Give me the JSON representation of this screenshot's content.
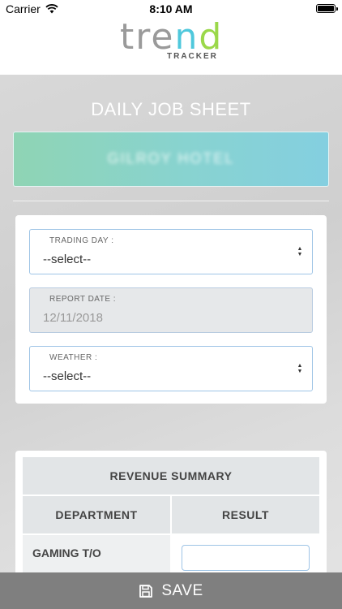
{
  "status_bar": {
    "carrier": "Carrier",
    "time": "8:10 AM"
  },
  "logo": {
    "word_part1": "tre",
    "word_n": "n",
    "word_d": "d",
    "subtitle": "TRACKER"
  },
  "page": {
    "title": "DAILY JOB SHEET",
    "venue_name": "GILROY HOTEL"
  },
  "form": {
    "trading_day": {
      "label": "TRADING DAY :",
      "value": "--select--"
    },
    "report_date": {
      "label": "REPORT DATE :",
      "value": "12/11/2018"
    },
    "weather": {
      "label": "WEATHER :",
      "value": "--select--"
    }
  },
  "revenue": {
    "title": "REVENUE SUMMARY",
    "col_department": "DEPARTMENT",
    "col_result": "RESULT",
    "rows": [
      {
        "label": "GAMING T/O",
        "value": ""
      }
    ]
  },
  "actions": {
    "save_label": "SAVE"
  },
  "colors": {
    "banner_start": "#8fd4b4",
    "banner_end": "#84cfe0",
    "save_bar": "#7f7f7f",
    "field_border": "#9ec4e6"
  }
}
